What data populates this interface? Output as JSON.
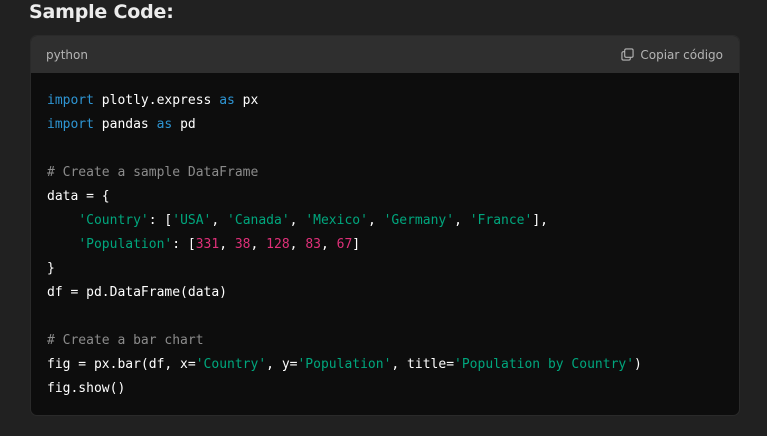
{
  "heading": "Sample Code:",
  "code_block": {
    "language": "python",
    "copy_label": "Copiar código",
    "copy_icon": "copy-icon",
    "lines": [
      [
        {
          "t": "kw",
          "v": "import"
        },
        {
          "t": "plain",
          "v": " plotly.express "
        },
        {
          "t": "kw",
          "v": "as"
        },
        {
          "t": "plain",
          "v": " px"
        }
      ],
      [
        {
          "t": "kw",
          "v": "import"
        },
        {
          "t": "plain",
          "v": " pandas "
        },
        {
          "t": "kw",
          "v": "as"
        },
        {
          "t": "plain",
          "v": " pd"
        }
      ],
      [],
      [
        {
          "t": "cmt",
          "v": "# Create a sample DataFrame"
        }
      ],
      [
        {
          "t": "plain",
          "v": "data = {"
        }
      ],
      [
        {
          "t": "plain",
          "v": "    "
        },
        {
          "t": "str",
          "v": "'Country'"
        },
        {
          "t": "plain",
          "v": ": ["
        },
        {
          "t": "str",
          "v": "'USA'"
        },
        {
          "t": "plain",
          "v": ", "
        },
        {
          "t": "str",
          "v": "'Canada'"
        },
        {
          "t": "plain",
          "v": ", "
        },
        {
          "t": "str",
          "v": "'Mexico'"
        },
        {
          "t": "plain",
          "v": ", "
        },
        {
          "t": "str",
          "v": "'Germany'"
        },
        {
          "t": "plain",
          "v": ", "
        },
        {
          "t": "str",
          "v": "'France'"
        },
        {
          "t": "plain",
          "v": "],"
        }
      ],
      [
        {
          "t": "plain",
          "v": "    "
        },
        {
          "t": "str",
          "v": "'Population'"
        },
        {
          "t": "plain",
          "v": ": ["
        },
        {
          "t": "num",
          "v": "331"
        },
        {
          "t": "plain",
          "v": ", "
        },
        {
          "t": "num",
          "v": "38"
        },
        {
          "t": "plain",
          "v": ", "
        },
        {
          "t": "num",
          "v": "128"
        },
        {
          "t": "plain",
          "v": ", "
        },
        {
          "t": "num",
          "v": "83"
        },
        {
          "t": "plain",
          "v": ", "
        },
        {
          "t": "num",
          "v": "67"
        },
        {
          "t": "plain",
          "v": "]"
        }
      ],
      [
        {
          "t": "plain",
          "v": "}"
        }
      ],
      [
        {
          "t": "plain",
          "v": "df = pd.DataFrame(data)"
        }
      ],
      [],
      [
        {
          "t": "cmt",
          "v": "# Create a bar chart"
        }
      ],
      [
        {
          "t": "plain",
          "v": "fig = px.bar(df, x="
        },
        {
          "t": "str",
          "v": "'Country'"
        },
        {
          "t": "plain",
          "v": ", y="
        },
        {
          "t": "str",
          "v": "'Population'"
        },
        {
          "t": "plain",
          "v": ", title="
        },
        {
          "t": "str",
          "v": "'Population by Country'"
        },
        {
          "t": "plain",
          "v": ")"
        }
      ],
      [
        {
          "t": "plain",
          "v": "fig.show()"
        }
      ]
    ]
  },
  "colors": {
    "page_bg": "#212121",
    "header_bg": "#2f2f2f",
    "code_bg": "#0d0d0d",
    "keyword": "#2e95d3",
    "string": "#00a67d",
    "number": "#df3079",
    "comment": "#8b8b8b"
  }
}
